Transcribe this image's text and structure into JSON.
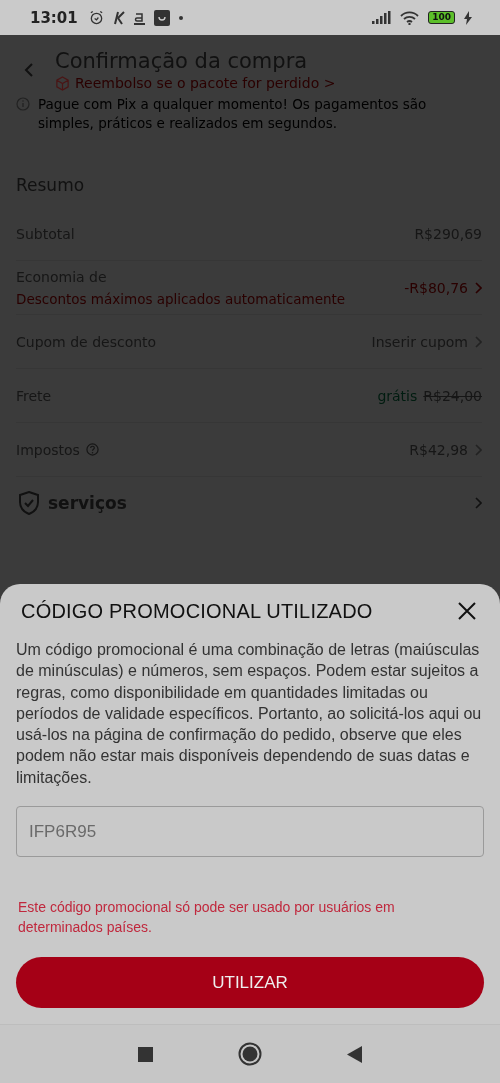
{
  "status_bar": {
    "time": "13:01",
    "battery": "100"
  },
  "header": {
    "title": "Confirmação da compra",
    "subtitle": "Reembolso se o pacote for perdido >"
  },
  "notice": "Pague com Pix a qualquer momento! Os pagamentos são simples, práticos e realizados em segundos.",
  "summary": {
    "title": "Resumo",
    "rows": [
      {
        "kind": "value",
        "label": "Subtotal",
        "value": "R$290,69"
      },
      {
        "kind": "discount",
        "label": "Economia de",
        "note": "Descontos máximos aplicados automaticamente",
        "value": "-R$80,76"
      },
      {
        "kind": "link",
        "label": "Cupom de desconto",
        "value": "Inserir cupom"
      },
      {
        "kind": "shipping",
        "label": "Frete",
        "value": "grátis",
        "old_value": "R$24,00"
      },
      {
        "kind": "info",
        "label": "Impostos",
        "value": "R$42,98"
      }
    ]
  },
  "services": {
    "label": "serviços"
  },
  "sheet": {
    "title": "CÓDIGO PROMOCIONAL UTILIZADO",
    "body": "Um código promocional é uma combinação de letras (maiúsculas de minúsculas) e números, sem espaços. Podem estar sujeitos a regras, como disponibilidade em quantidades limitadas ou períodos de validade específicos. Portanto, ao solicitá-los aqui ou usá-los na página de confirmação do pedido, observe que eles podem não estar mais disponíveis dependendo de suas datas e limitações.",
    "code": "IFP6R95",
    "error": "Este código promocional só pode ser usado por usuários em determinados países.",
    "button": "UTILIZAR"
  }
}
